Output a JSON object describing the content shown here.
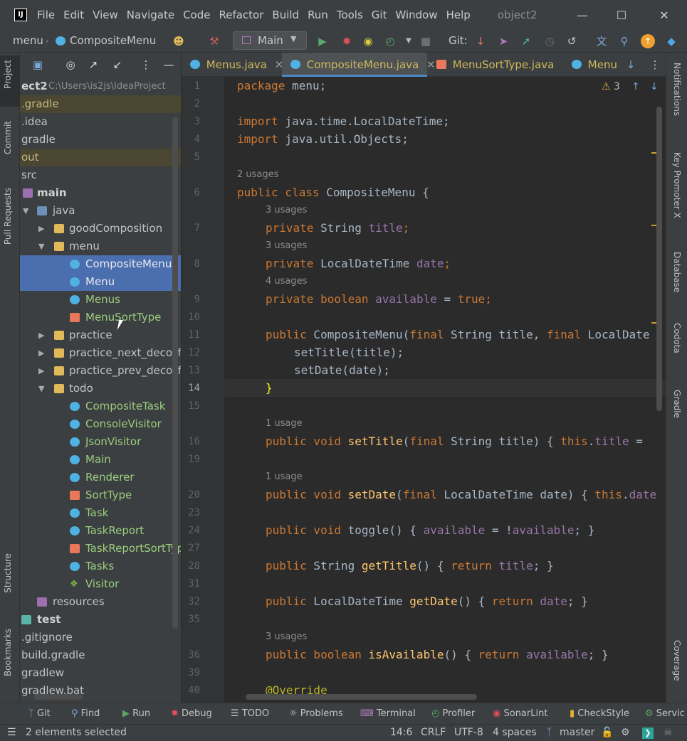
{
  "app": {
    "window_title": "object2",
    "logo": "IJ"
  },
  "menu": [
    "File",
    "Edit",
    "View",
    "Navigate",
    "Code",
    "Refactor",
    "Build",
    "Run",
    "Tools",
    "Git",
    "Window",
    "Help"
  ],
  "breadcrumb": {
    "first": "menu",
    "second": "CompositeMenu"
  },
  "run_config": "Main",
  "git_label": "Git:",
  "project_panel": {
    "root_label": "ect2",
    "root_path": "C:\\Users\\is2js\\IdeaProject",
    "rows": [
      {
        "label": ".gradle"
      },
      {
        "label": ".idea"
      },
      {
        "label": "gradle"
      },
      {
        "label": "out"
      },
      {
        "label": "src"
      },
      {
        "label": "main"
      },
      {
        "label": "java"
      },
      {
        "label": "goodComposition"
      },
      {
        "label": "menu"
      },
      {
        "label": "CompositeMenu"
      },
      {
        "label": "Menu"
      },
      {
        "label": "Menus"
      },
      {
        "label": "MenuSortType"
      },
      {
        "label": "practice"
      },
      {
        "label": "practice_next_deco_for_"
      },
      {
        "label": "practice_prev_deco_for_"
      },
      {
        "label": "todo"
      },
      {
        "label": "CompositeTask"
      },
      {
        "label": "ConsoleVisitor"
      },
      {
        "label": "JsonVisitor"
      },
      {
        "label": "Main"
      },
      {
        "label": "Renderer"
      },
      {
        "label": "SortType"
      },
      {
        "label": "Task"
      },
      {
        "label": "TaskReport"
      },
      {
        "label": "TaskReportSortType"
      },
      {
        "label": "Tasks"
      },
      {
        "label": "Visitor"
      },
      {
        "label": "resources"
      },
      {
        "label": "test"
      },
      {
        "label": ".gitignore"
      },
      {
        "label": "build.gradle"
      },
      {
        "label": "gradlew"
      },
      {
        "label": "gradlew.bat"
      }
    ]
  },
  "tabs": [
    {
      "label": "Menus.java"
    },
    {
      "label": "CompositeMenu.java"
    },
    {
      "label": "MenuSortType.java"
    },
    {
      "label": "Menu"
    }
  ],
  "editor": {
    "warnings": "3",
    "line_numbers": [
      "1",
      "2",
      "3",
      "4",
      "5",
      "6",
      "7",
      "8",
      "9",
      "10",
      "11",
      "12",
      "13",
      "14",
      "15",
      "16",
      "19",
      "20",
      "23",
      "24",
      "27",
      "28",
      "31",
      "32",
      "35",
      "36",
      "39",
      "40"
    ],
    "hints": {
      "h1": "2 usages",
      "h2": "3 usages",
      "h3": "3 usages",
      "h4": "4 usages",
      "h5": "1 usage",
      "h6": "1 usage",
      "h7": "3 usages"
    },
    "lines": {
      "l1a": "package",
      "l1b": " menu;",
      "l3a": "import",
      "l3b": " java.time.LocalDateTime;",
      "l4a": "import",
      "l4b": " java.util.Objects;",
      "l6a": "public class",
      "l6b": " CompositeMenu {",
      "l7a": "private",
      "l7b": " String ",
      "l7c": "title",
      "l7d": ";",
      "l8a": "private",
      "l8b": " LocalDateTime ",
      "l8c": "date",
      "l8d": ";",
      "l9a": "private boolean",
      "l9b": "available",
      "l9c": " = ",
      "l9d": "true",
      "l9e": ";",
      "l11a": "public",
      "l11b": " CompositeMenu(",
      "l11c": "final",
      "l11d": " String title, ",
      "l11e": "final",
      "l11f": " LocalDate",
      "l12": "setTitle(title);",
      "l13": "setDate(date);",
      "l14": "}",
      "l16a": "public void",
      "l16b": "setTitle",
      "l16c": "(",
      "l16d": "final",
      "l16e": " String title) { ",
      "l16f": "this",
      "l16g": ".",
      "l16h": "title",
      "l16i": " = ",
      "l20a": "public void",
      "l20b": "setDate",
      "l20c": "(",
      "l20d": "final",
      "l20e": " LocalDateTime date) { ",
      "l20f": "this",
      "l20g": ".",
      "l20h": "date",
      "l24a": "public void",
      "l24b": " toggle() { ",
      "l24c": "available",
      "l24d": " = !",
      "l24e": "available",
      "l24f": "; }",
      "l28a": "public",
      "l28b": " String ",
      "l28c": "getTitle",
      "l28d": "() { ",
      "l28e": "return",
      "l28f": "title",
      "l28g": "; }",
      "l32a": "public",
      "l32b": " LocalDateTime ",
      "l32c": "getDate",
      "l32d": "() { ",
      "l32e": "return",
      "l32f": "date",
      "l32g": "; }",
      "l36a": "public boolean",
      "l36b": "isAvailable",
      "l36c": "() { ",
      "l36d": "return",
      "l36e": "available",
      "l36f": "; }",
      "l40": "@Override"
    }
  },
  "left_tabs": {
    "project": "Project",
    "commit": "Commit",
    "pull": "Pull Requests",
    "structure": "Structure",
    "bookmarks": "Bookmarks"
  },
  "right_tabs": {
    "notifications": "Notifications",
    "keypromoter": "Key Promoter X",
    "database": "Database",
    "codota": "Codota",
    "gradle": "Gradle",
    "coverage": "Coverage"
  },
  "bottom_tools": [
    "Git",
    "Find",
    "Run",
    "Debug",
    "TODO",
    "Problems",
    "Terminal",
    "Profiler",
    "SonarLint",
    "CheckStyle",
    "Servic"
  ],
  "status": {
    "selection": "2 elements selected",
    "position": "14:6",
    "line_sep": "CRLF",
    "encoding": "UTF-8",
    "indent": "4 spaces",
    "branch": "master"
  },
  "colors": {
    "keyword": "#cc7832",
    "field": "#9876aa",
    "method": "#ffc66d",
    "selection": "#4b6eaf",
    "accent": "#4a88c7"
  }
}
